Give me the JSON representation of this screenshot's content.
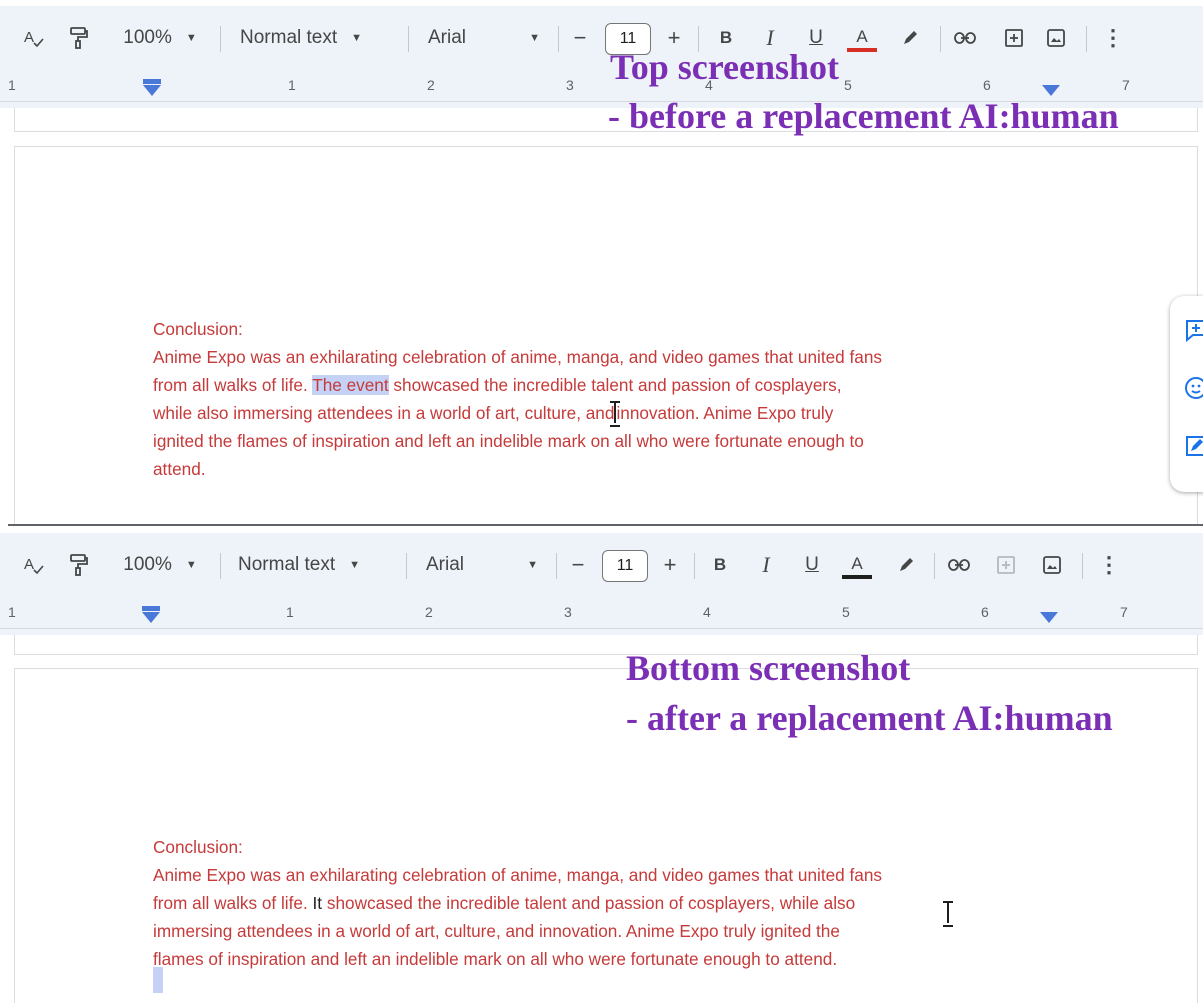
{
  "toolbar": {
    "zoom": "100%",
    "style": "Normal text",
    "font": "Arial",
    "font_size": "11",
    "bold": "B",
    "italic": "I",
    "underline": "U",
    "text_color": "A",
    "more": "⋮",
    "minus": "−",
    "plus": "+"
  },
  "ruler": {
    "labels": [
      "1",
      "1",
      "2",
      "3",
      "4",
      "5",
      "6",
      "7"
    ]
  },
  "overlay": {
    "top_line1": "Top screenshot",
    "top_line2": "- before a replacement AI:human",
    "bottom_line1": "Bottom screenshot",
    "bottom_line2": "- after a replacement AI:human"
  },
  "before": {
    "heading": "Conclusion:",
    "line1": "Anime Expo was an exhilarating celebration of anime, manga, and video games that united fans",
    "line2_pre": "from all walks of life. ",
    "line2_hl": "The event",
    "line2_post": " showcased the incredible talent and passion of cosplayers,",
    "line3_pre": "while also immersing attendees in a world of art, culture, and",
    "line3_post": "innovation. Anime Expo truly",
    "line4": "ignited the flames of inspiration and left an indelible mark on all who were fortunate enough to",
    "line5": "attend."
  },
  "after": {
    "heading": "Conclusion:",
    "line1": "Anime Expo was an exhilarating celebration of anime, manga, and video games that united fans",
    "line2_pre": "from all walks of life. ",
    "line2_new": "It",
    "line2_post": " showcased the incredible talent and passion of cosplayers, while also",
    "line3": "immersing attendees in a world of art, culture, and innovation. Anime Expo truly ignited the",
    "line4": "flames of inspiration and left an indelible mark on all who were fortunate enough to attend."
  },
  "colors": {
    "doc_text": "#c63a3a",
    "toolbar_bg": "#eef2f9",
    "overlay": "#7b2fb5",
    "selection": "#c4d3f5",
    "accent": "#1a73e8"
  }
}
